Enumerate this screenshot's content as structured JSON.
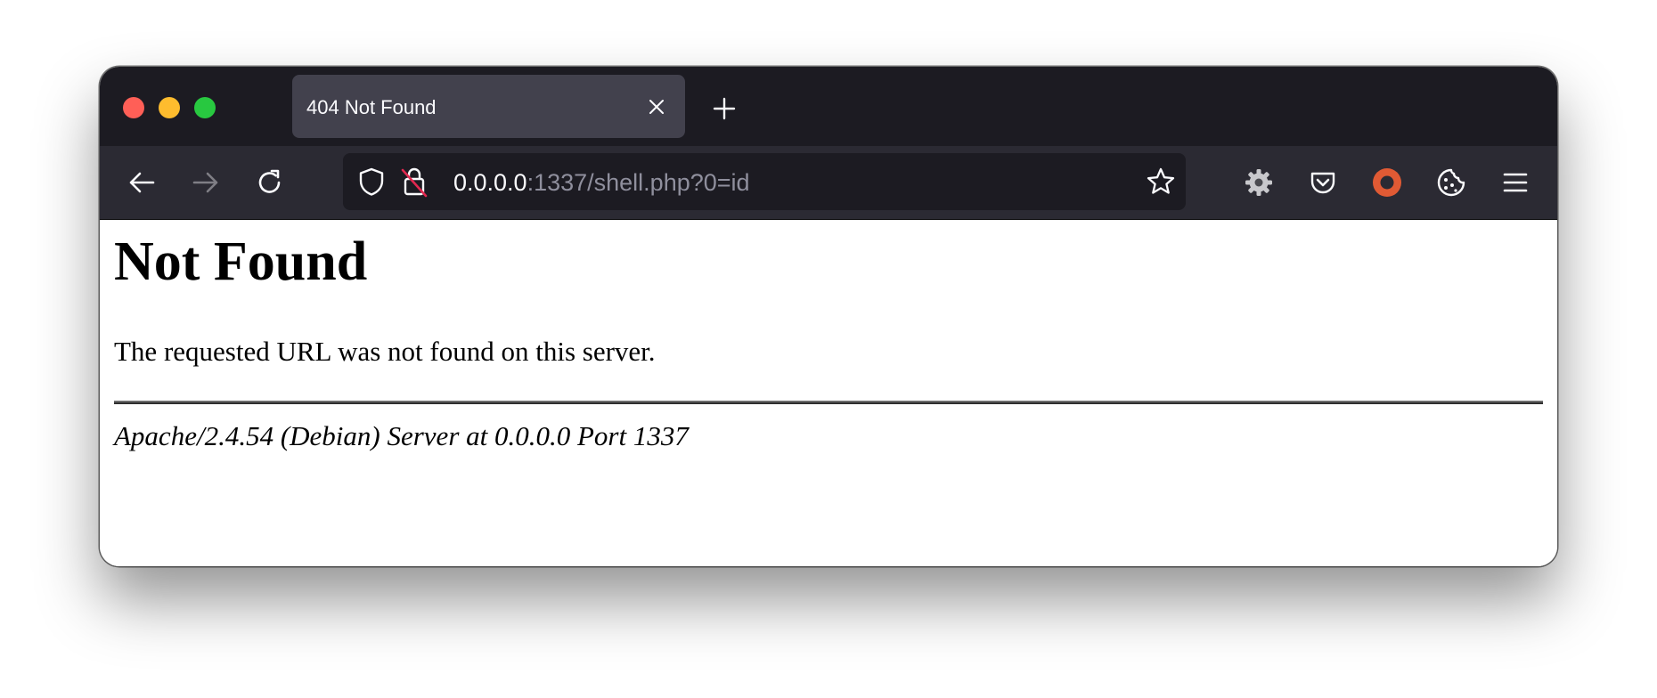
{
  "browser": {
    "tab": {
      "title": "404 Not Found"
    },
    "urlbar": {
      "host": "0.0.0.0",
      "path": ":1337/shell.php?0=id"
    },
    "icons": {
      "back": "arrow-left-icon",
      "forward": "arrow-right-icon",
      "reload": "reload-icon",
      "tracking_protection": "shield-icon",
      "connection": "insecure-lock-icon",
      "bookmark": "star-icon",
      "extension_settings": "gear-icon",
      "pocket": "pocket-icon",
      "extension": "record-icon",
      "cookie": "cookie-icon",
      "menu": "hamburger-menu-icon",
      "new_tab": "plus-icon",
      "close_tab": "close-icon"
    },
    "colors": {
      "titlebar": "#1c1b22",
      "toolbar": "#2b2a33",
      "tab_selected": "#42414d",
      "close_button": "#ff5f57",
      "minimize_button": "#febc2e",
      "zoom_button": "#28c840",
      "extension_accent": "#e05a34"
    }
  },
  "page": {
    "heading": "Not Found",
    "message": "The requested URL was not found on this server.",
    "server_signature": "Apache/2.4.54 (Debian) Server at 0.0.0.0 Port 1337"
  }
}
